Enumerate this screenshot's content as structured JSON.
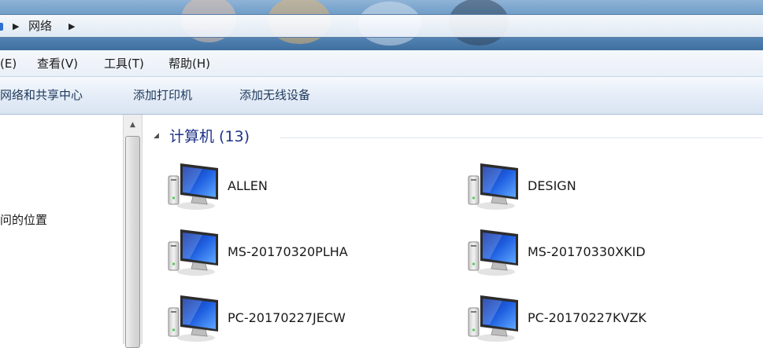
{
  "address_bar": {
    "crumbs": [
      "网络"
    ]
  },
  "menu": {
    "items": [
      {
        "id": "edit",
        "label": "(E)"
      },
      {
        "id": "view",
        "label": "查看(V)"
      },
      {
        "id": "tools",
        "label": "工具(T)"
      },
      {
        "id": "help",
        "label": "帮助(H)"
      }
    ]
  },
  "toolbar": {
    "items": [
      {
        "id": "network-sharing-center",
        "label": "网络和共享中心"
      },
      {
        "id": "add-printer",
        "label": "添加打印机"
      },
      {
        "id": "add-wireless-device",
        "label": "添加无线设备"
      }
    ]
  },
  "nav_pane": {
    "partial_item": "问的位置"
  },
  "group": {
    "title": "计算机 (13)"
  },
  "computers": [
    {
      "name": "ALLEN"
    },
    {
      "name": "DESIGN"
    },
    {
      "name": "MS-20170320PLHA"
    },
    {
      "name": "MS-20170330XKID"
    },
    {
      "name": "PC-20170227JECW"
    },
    {
      "name": "PC-20170227KVZK"
    }
  ],
  "icons": {
    "computer": "computer-icon",
    "breadcrumb_separator": "chevron-right-icon",
    "collapse": "collapse-triangle-icon",
    "scroll_up": "scroll-up-arrow-icon"
  },
  "colors": {
    "group_title": "#1e3287",
    "toolbar_text": "#1e395b",
    "titlebar": "#5e8fc0"
  }
}
